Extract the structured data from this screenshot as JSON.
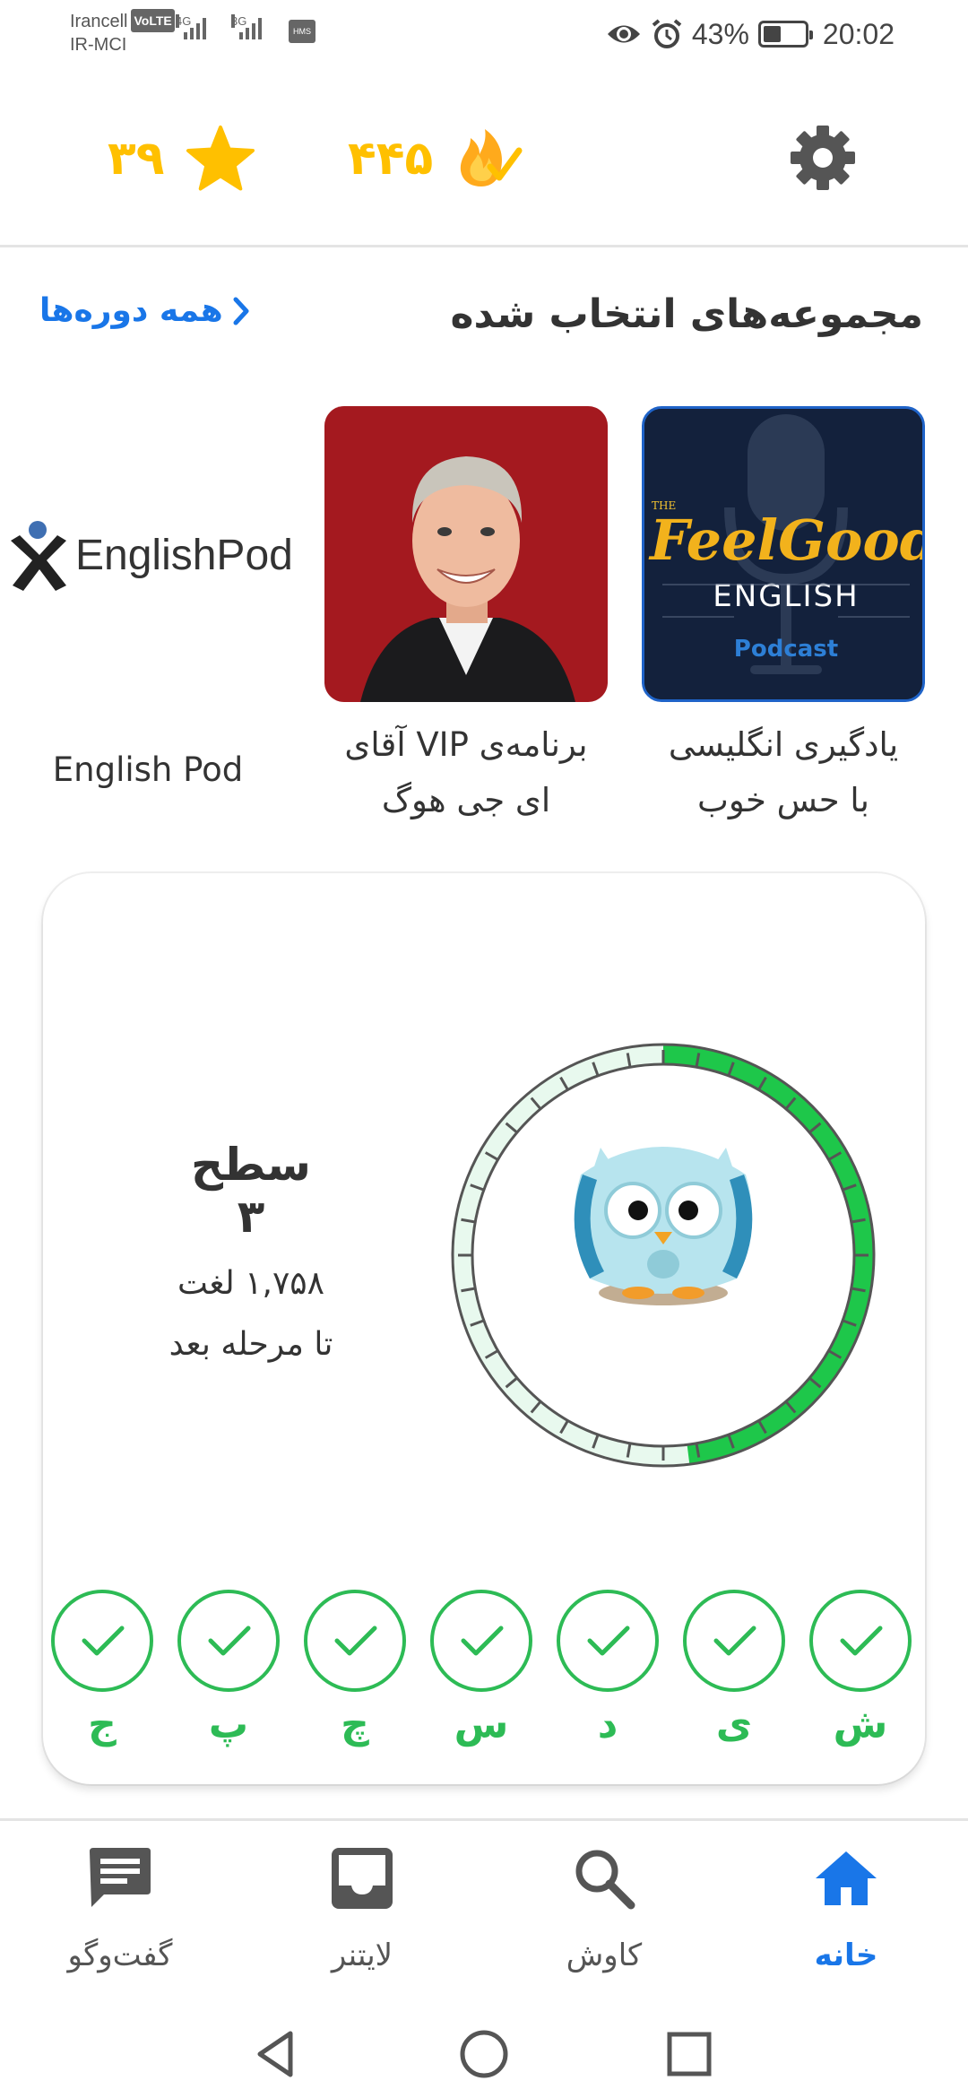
{
  "status_bar": {
    "carrier_1": "Irancell",
    "volte": "VoLTE",
    "carrier_2": "IR-MCI",
    "net_1": "4G",
    "net_2": "3G",
    "hms": "HMS",
    "battery_percent": "43%",
    "battery_level": 0.43,
    "time": "20:02",
    "icons": [
      "eye-icon",
      "alarm-icon",
      "battery-icon"
    ]
  },
  "top_bar": {
    "stars_count": "۳۹",
    "streak_count": "۴۴۵",
    "icons": [
      "star-icon",
      "streak-flame-icon",
      "gear-icon"
    ],
    "accent_color": "#ffc000"
  },
  "section": {
    "title": "مجموعه‌های انتخاب شده",
    "all_courses_link": "همه دوره‌ها"
  },
  "collections": [
    {
      "label_line1": "یادگیری انگلیسی",
      "label_line2": "با حس خوب",
      "logo_small": "THE",
      "logo_main_1": "Feel",
      "logo_main_2": "Good",
      "logo_word": "ENGLISH",
      "logo_sub": "Podcast"
    },
    {
      "label_line1": "برنامه‌ی VIP آقای",
      "label_line2": "ای جی هوگ"
    },
    {
      "label_line1": "English Pod",
      "logo_text": "EnglishPod"
    }
  ],
  "level": {
    "title": "سطح ۳",
    "words": "۱,۷۵۸ لغت",
    "until_next": "تا مرحله بعد",
    "progress": 0.48,
    "progress_color": "#1ec74a"
  },
  "week_days": [
    {
      "letter": "ش",
      "done": true
    },
    {
      "letter": "ی",
      "done": true
    },
    {
      "letter": "د",
      "done": true
    },
    {
      "letter": "س",
      "done": true
    },
    {
      "letter": "چ",
      "done": true
    },
    {
      "letter": "پ",
      "done": true
    },
    {
      "letter": "ج",
      "done": true
    }
  ],
  "bottom_nav": {
    "home": "خانه",
    "explore": "کاوش",
    "leitner": "لایتنر",
    "chat": "گفت‌وگو",
    "active_color": "#1976e8",
    "icons": [
      "home-icon",
      "search-icon",
      "inbox-icon",
      "chat-icon"
    ]
  },
  "system_nav": {
    "icons": [
      "back-icon",
      "home-circle-icon",
      "recents-icon"
    ]
  }
}
